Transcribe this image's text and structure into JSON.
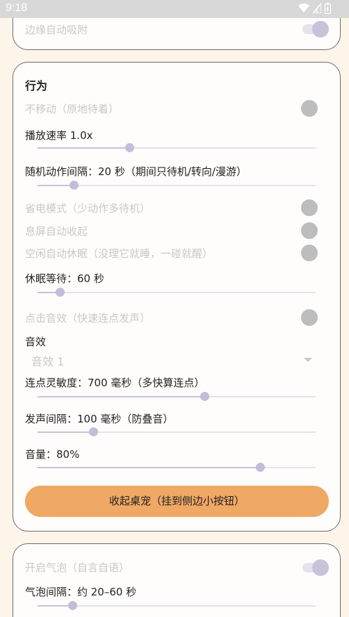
{
  "status": {
    "time": "9:18"
  },
  "card_top": {
    "edge_snap_label": "边缘自动吸附"
  },
  "behavior": {
    "title": "行为",
    "stay_label": "不移动（原地待着）",
    "speed_label": "播放速率 1.0x",
    "speed_value": 0.33,
    "interval_label": "随机动作间隔：20 秒（期间只待机/转向/漫游）",
    "interval_value": 0.13,
    "power_save_label": "省电模式（少动作多待机）",
    "screen_off_label": "息屏自动收起",
    "idle_sleep_label": "空闲自动休眠（没理它就睡，一碰就醒）",
    "sleep_wait_label": "休眠等待：60 秒",
    "sleep_wait_value": 0.08,
    "click_sound_label": "点击音效（快速连点发声）",
    "sound_label": "音效",
    "sound_selected": "音效 1",
    "sensitivity_label": "连点灵敏度：700 毫秒（多快算连点）",
    "sensitivity_value": 0.6,
    "sound_interval_label": "发声间隔：100 毫秒（防叠音）",
    "sound_interval_value": 0.2,
    "volume_label": "音量：80%",
    "volume_value": 0.8,
    "collapse_button": "收起桌宠（挂到侧边小按钮）"
  },
  "bubble": {
    "enable_label": "开启气泡（自言自语）",
    "interval_label": "气泡间隔：约 20–60 秒",
    "interval_value": 0.125
  }
}
